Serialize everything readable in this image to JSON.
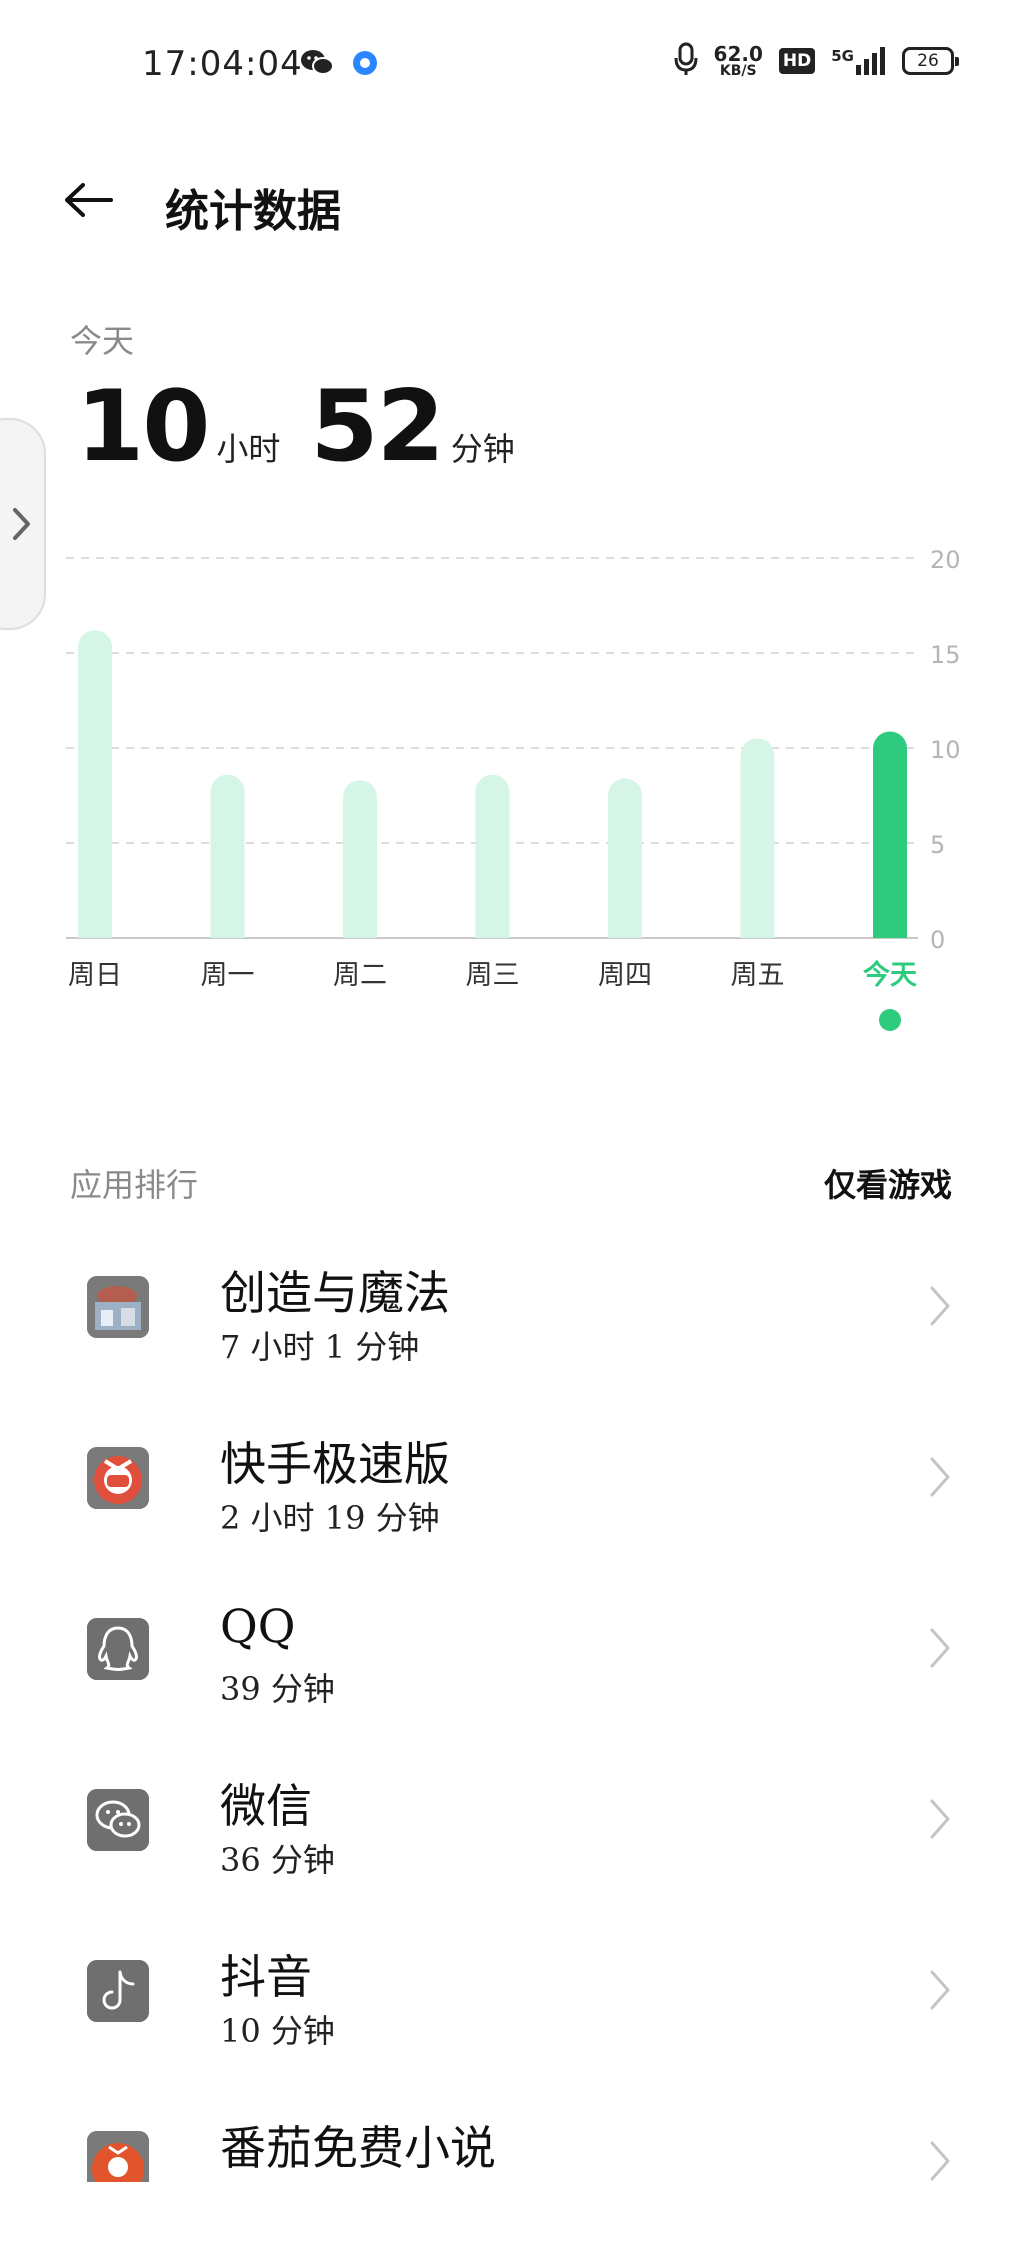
{
  "status_bar": {
    "time": "17:04:04",
    "net_speed_value": "62.0",
    "net_speed_unit": "KB/S",
    "hd": "HD",
    "network": "5G",
    "battery": "26",
    "left_icons": [
      "wechat-icon",
      "notification-dot-icon"
    ],
    "right_icons": [
      "microphone-icon",
      "signal-icon",
      "battery-icon"
    ]
  },
  "header": {
    "title": "统计数据"
  },
  "summary": {
    "period_label": "今天",
    "hours": "10",
    "hours_unit": "小时",
    "minutes": "52",
    "minutes_unit": "分钟"
  },
  "chart_data": {
    "type": "bar",
    "categories": [
      "周日",
      "周一",
      "周二",
      "周三",
      "周四",
      "周五",
      "今天"
    ],
    "values": [
      16.2,
      8.6,
      8.3,
      8.6,
      8.4,
      10.5,
      10.87
    ],
    "ylim": [
      0,
      20
    ],
    "y_ticks": [
      "0",
      "5",
      "10",
      "15",
      "20"
    ],
    "grid": true,
    "highlight_index": 6,
    "colors": {
      "bar": "#d5f5e6",
      "highlight": "#2ecb7e",
      "grid": "#dcdcdc",
      "tick": "#b5b5b5",
      "label": "#333333"
    }
  },
  "ranking": {
    "title": "应用排行",
    "filter_label": "仅看游戏",
    "apps": [
      {
        "name": "创造与魔法",
        "time": "7 小时 1 分钟",
        "icon": "creation-magic-icon"
      },
      {
        "name": "快手极速版",
        "time": "2 小时 19 分钟",
        "icon": "kuaishou-icon"
      },
      {
        "name": "QQ",
        "time": "39 分钟",
        "icon": "qq-penguin-icon"
      },
      {
        "name": "微信",
        "time": "36 分钟",
        "icon": "wechat-icon"
      },
      {
        "name": "抖音",
        "time": "10 分钟",
        "icon": "douyin-icon"
      },
      {
        "name": "番茄免费小说",
        "time": "",
        "icon": "tomato-novel-icon"
      }
    ]
  }
}
